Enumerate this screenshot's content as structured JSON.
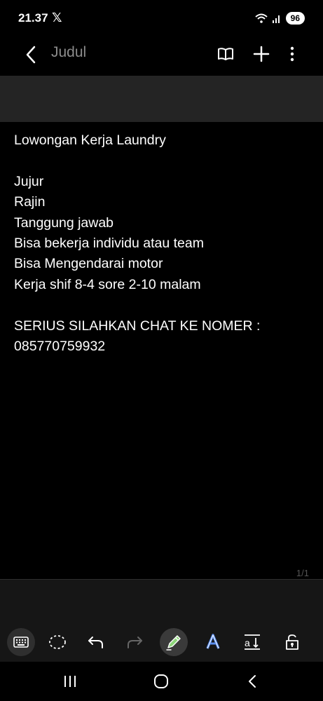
{
  "status_bar": {
    "time": "21.37",
    "notification_icon": "x-logo-icon",
    "battery_level": "96"
  },
  "app_bar": {
    "title": "Judul"
  },
  "note": {
    "lines": [
      "Lowongan Kerja Laundry",
      "",
      "Jujur",
      "Rajin",
      "Tanggung jawab",
      "Bisa bekerja individu atau team",
      "Bisa Mengendarai motor",
      "Kerja shif 8-4 sore 2-10 malam",
      "",
      "SERIUS SILAHKAN CHAT KE NOMER :",
      "085770759932"
    ]
  },
  "page_indicator": "1/1",
  "pen_toolbar": {
    "tools": [
      "keyboard-icon",
      "lasso-icon",
      "undo-icon",
      "redo-icon",
      "pen-icon",
      "text-style-icon",
      "text-size-icon",
      "lock-icon"
    ],
    "accent_color": "#5a8dee"
  },
  "nav_bar": {
    "buttons": [
      "recents-icon",
      "home-icon",
      "back-icon"
    ]
  }
}
